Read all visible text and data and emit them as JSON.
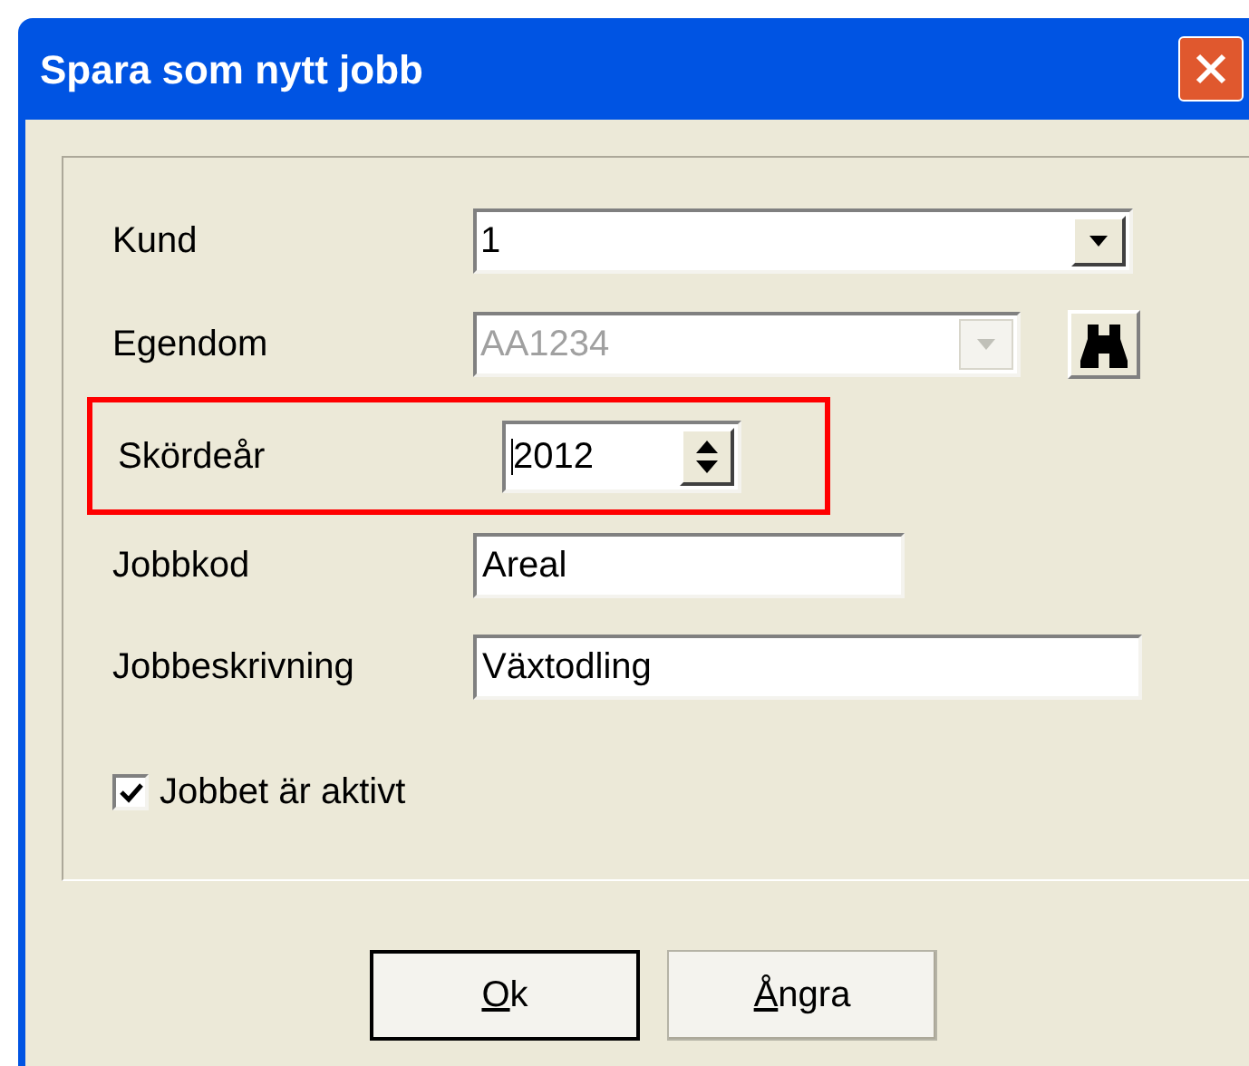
{
  "window": {
    "title": "Spara som nytt jobb"
  },
  "fields": [
    {
      "kind": "combo",
      "label": "Kund",
      "value": "1",
      "disabled": false,
      "highlighted": false
    },
    {
      "kind": "combo_search",
      "label": "Egendom",
      "value": "AA1234",
      "disabled": true,
      "highlighted": false
    },
    {
      "kind": "spin",
      "label": "Skördeår",
      "value": "2012",
      "disabled": false,
      "highlighted": true
    },
    {
      "kind": "text_short",
      "label": "Jobbkod",
      "value": "Areal",
      "disabled": false,
      "highlighted": false
    },
    {
      "kind": "text_long",
      "label": "Jobbeskrivning",
      "value": "Växtodling",
      "disabled": false,
      "highlighted": false
    }
  ],
  "checkbox": {
    "label": "Jobbet är aktivt",
    "checked": true
  },
  "buttons": [
    {
      "label": "Ok",
      "mnemonic_underlined": true,
      "default": true
    },
    {
      "label": "Ångra",
      "mnemonic_underlined": true,
      "default": false
    }
  ]
}
